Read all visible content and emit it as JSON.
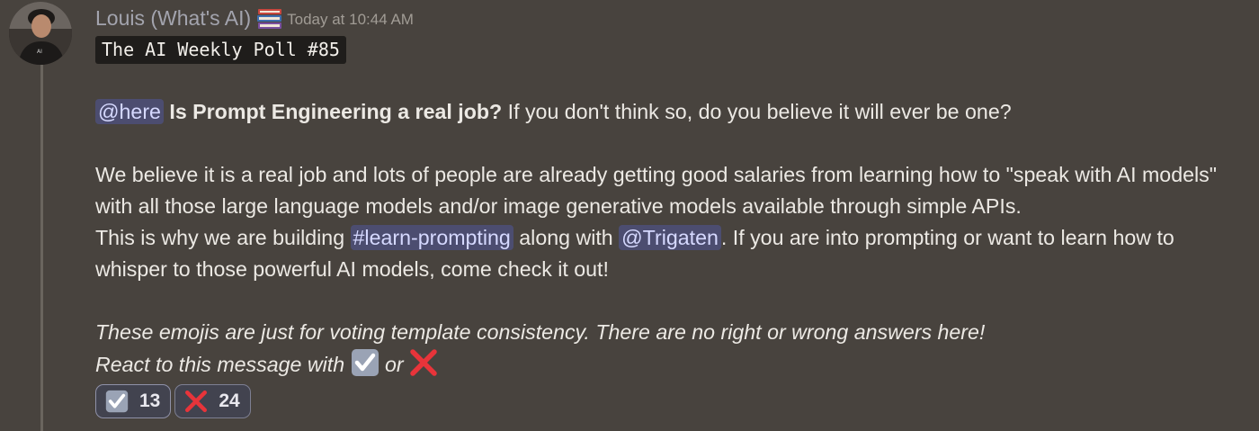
{
  "author": {
    "name": "Louis (What's AI)",
    "badge_icon": "books-icon",
    "timestamp": "Today at 10:44 AM",
    "avatar": "avatar"
  },
  "message": {
    "code_title": "The AI Weekly Poll #85",
    "line1": {
      "mention": "@here",
      "bold": "Is Prompt Engineering a real job?",
      "rest": " If you don't think so, do you believe it will ever be one?"
    },
    "para2": "We believe it is a real job and lots of people are already getting good salaries from learning how to \"speak with AI models\" with all those large language models and/or image generative models available through simple APIs.",
    "para3": {
      "before": "This is why we are building ",
      "channel": "#learn-prompting",
      "middle": " along with ",
      "user_mention": "@Trigaten",
      "after": ". If you are into prompting or want to learn how to whisper to those powerful AI models, come check it out!"
    },
    "italic_line1": "These emojis are just for voting template consistency. There are no right or wrong answers here!",
    "italic_line2_before": "React to this message with ",
    "italic_line2_or": " or ",
    "emoji_check": "ballot-box-with-check-icon",
    "emoji_cross": "cross-mark-icon"
  },
  "reactions": [
    {
      "icon": "ballot-box-with-check-icon",
      "count": "13"
    },
    {
      "icon": "cross-mark-icon",
      "count": "24"
    }
  ],
  "colors": {
    "background": "#48433e",
    "mention_bg": "#4c4d70",
    "mention_text": "#d6d9ff",
    "username": "#a3a4ae",
    "cross_red": "#e8343a",
    "check_box": "#9aa3b5"
  }
}
